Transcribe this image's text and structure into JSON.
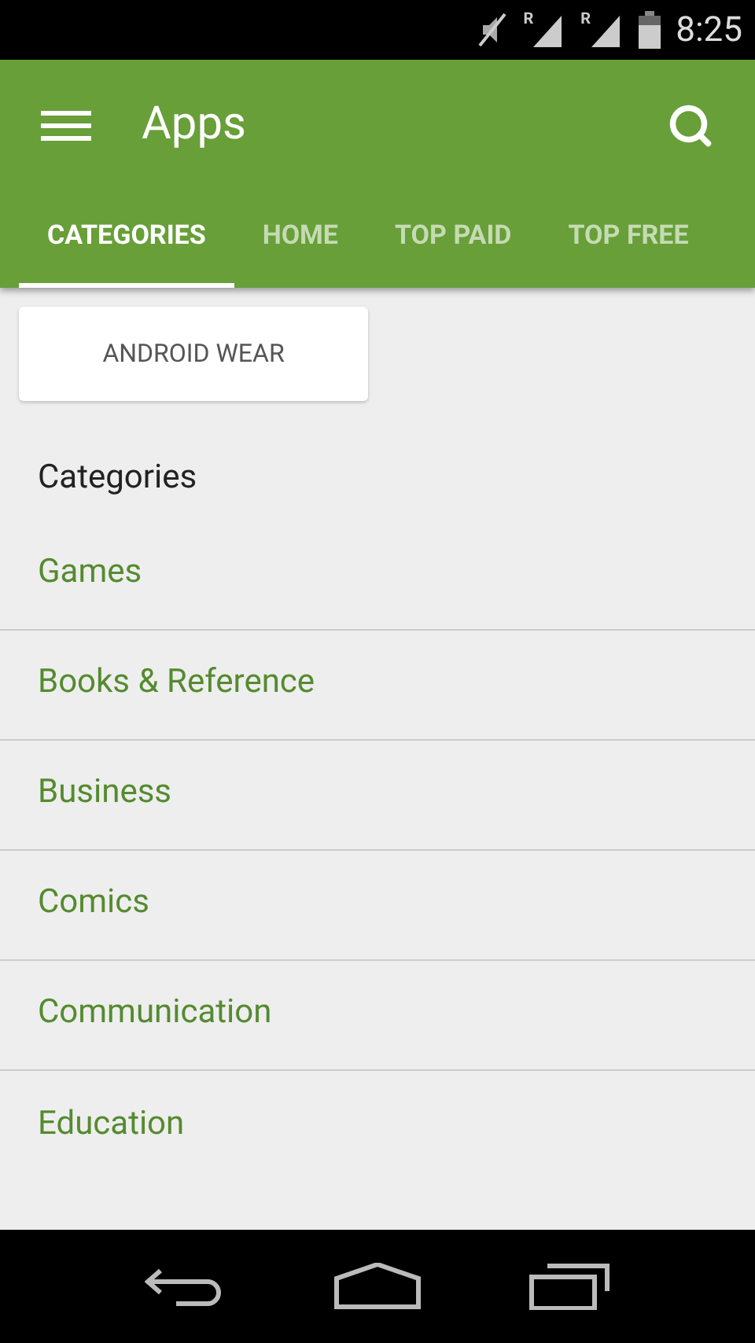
{
  "status_bar": {
    "signals": [
      {
        "label": "R"
      },
      {
        "label": "R"
      }
    ],
    "time": "8:25"
  },
  "toolbar": {
    "title": "Apps"
  },
  "tabs": [
    {
      "label": "CATEGORIES",
      "selected": true
    },
    {
      "label": "HOME",
      "selected": false
    },
    {
      "label": "TOP PAID",
      "selected": false
    },
    {
      "label": "TOP FREE",
      "selected": false
    }
  ],
  "featured_button": "ANDROID WEAR",
  "section_title": "Categories",
  "categories": [
    "Games",
    "Books & Reference",
    "Business",
    "Comics",
    "Communication",
    "Education"
  ]
}
